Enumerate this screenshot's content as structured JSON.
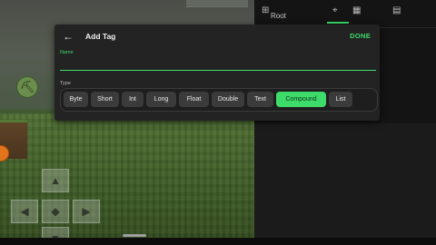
{
  "dialog": {
    "title": "Add Tag",
    "done_label": "DONE",
    "name_label": "Name",
    "name_value": "",
    "type_label": "Type",
    "types": [
      "Byte",
      "Short",
      "Int",
      "Long",
      "Float",
      "Double",
      "Text",
      "Compound",
      "List"
    ],
    "selected_type": "Compound",
    "accent_color": "#3ddc6a"
  },
  "right_panel": {
    "root_label": "Root"
  },
  "icons": {
    "back": "arrow-left-icon",
    "pickaxe": "pickaxe-icon",
    "dpad": [
      "arrow-up-icon",
      "arrow-left-icon",
      "arrow-right-icon",
      "arrow-down-icon",
      "diamond-icon"
    ]
  }
}
